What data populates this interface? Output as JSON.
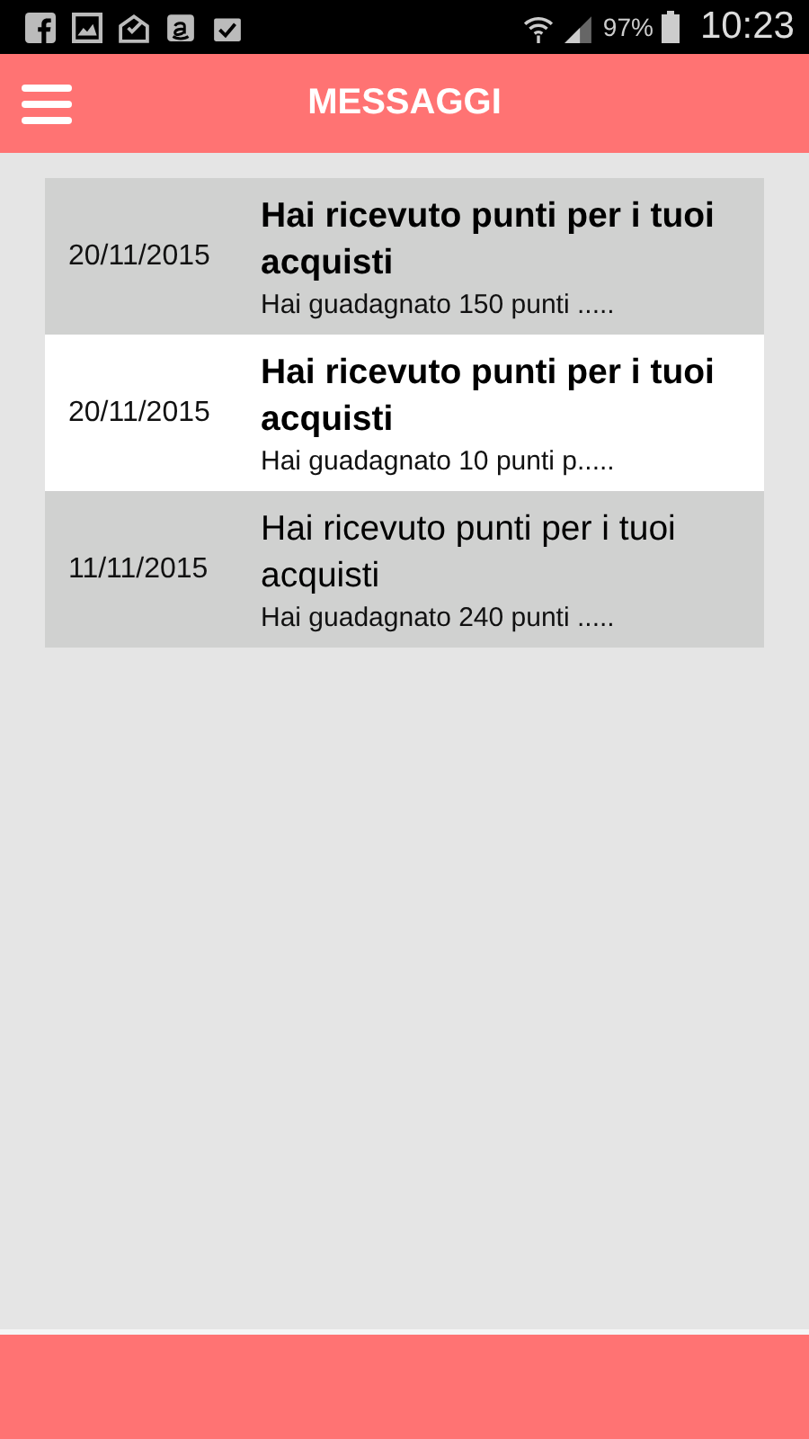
{
  "status_bar": {
    "battery_percent": "97%",
    "time": "10:23"
  },
  "header": {
    "title": "MESSAGGI"
  },
  "messages": [
    {
      "date": "20/11/2015",
      "title": "Hai ricevuto punti per i tuoi acquisti",
      "preview": "Hai guadagnato 150 punti .....",
      "unread": true,
      "selected": false
    },
    {
      "date": "20/11/2015",
      "title": "Hai ricevuto punti per i tuoi acquisti",
      "preview": "Hai guadagnato 10 punti p.....",
      "unread": true,
      "selected": true
    },
    {
      "date": "11/11/2015",
      "title": "Hai ricevuto punti per i tuoi acquisti",
      "preview": "Hai guadagnato 240 punti .....",
      "unread": false,
      "selected": false
    }
  ]
}
